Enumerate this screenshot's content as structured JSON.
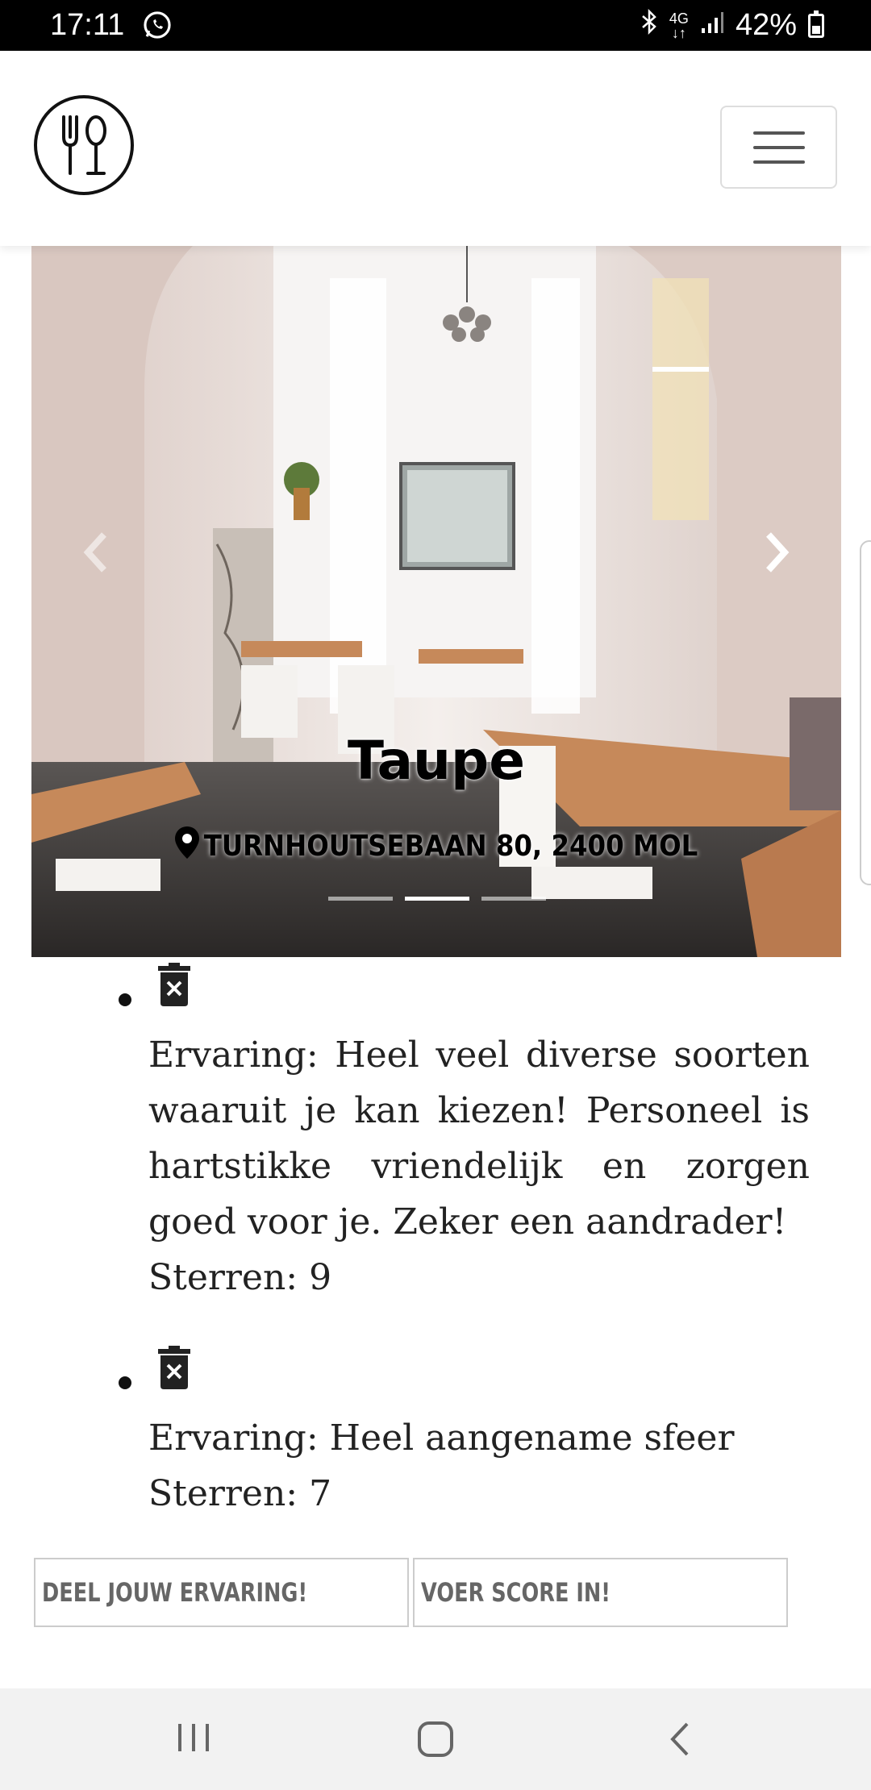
{
  "status_bar": {
    "time": "17:11",
    "network": "4G",
    "battery": "42%"
  },
  "carousel": {
    "restaurant_name": "Taupe",
    "address": "TURNHOUTSEBAAN 80, 2400 MOL",
    "slide_count": 3,
    "active_slide": 2
  },
  "reviews": [
    {
      "text": "Ervaring: Heel veel diverse soorten waaruit je kan kiezen! Personeel is hartstikke vriendelijk en zorgen goed voor je. Zeker een aandrader!",
      "stars": "Sterren: 9"
    },
    {
      "text": "Ervaring: Heel aangename sfeer",
      "stars": "Sterren: 7"
    }
  ],
  "actions": {
    "share_label": "DEEL JOUW ERVARING!",
    "score_label": "VOER SCORE IN!"
  },
  "colors": {
    "status_bar": "#000000",
    "nav_bar": "#f2f2f2",
    "button_border": "#cccccc",
    "button_text": "#666666"
  }
}
